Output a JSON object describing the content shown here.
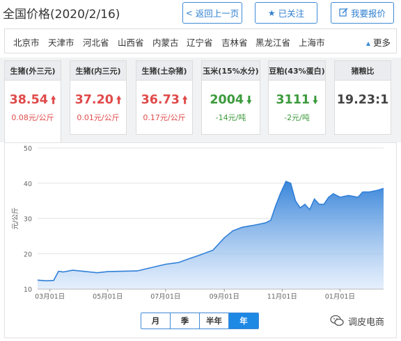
{
  "header": {
    "title": "全国价格(2020/2/16)",
    "back_label": "返回上一页",
    "follow_label": "已关注",
    "report_label": "我要报价"
  },
  "regions": {
    "items": [
      "北京市",
      "天津市",
      "河北省",
      "山西省",
      "内蒙古",
      "辽宁省",
      "吉林省",
      "黑龙江省",
      "上海市"
    ],
    "more_label": "更多"
  },
  "cards": [
    {
      "title": "生猪(外三元)",
      "value": "38.54",
      "trend": "up",
      "change": "0.08元/公斤"
    },
    {
      "title": "生猪(内三元)",
      "value": "37.20",
      "trend": "up",
      "change": "0.01元/公斤"
    },
    {
      "title": "生猪(土杂猪)",
      "value": "36.73",
      "trend": "up",
      "change": "0.17元/公斤"
    },
    {
      "title": "玉米(15%水分)",
      "value": "2004",
      "trend": "down",
      "change": "-14元/吨"
    },
    {
      "title": "豆粕(43%蛋白)",
      "value": "3111",
      "trend": "down",
      "change": "-2元/吨"
    },
    {
      "title": "猪粮比",
      "value": "19.23:1",
      "trend": "none",
      "change": ""
    }
  ],
  "colors": {
    "accent": "#1e88e5",
    "up": "#e04a4a",
    "down": "#3c9a3c",
    "line": "#2f7fd8"
  },
  "chart_data": {
    "type": "area",
    "ylabel": "元/公斤",
    "ylim": [
      10,
      50
    ],
    "yticks": [
      10,
      20,
      30,
      40,
      50
    ],
    "grid": true,
    "xticks": [
      "03月01日",
      "05月01日",
      "07月01日",
      "09月01日",
      "11月01日",
      "01月01日"
    ],
    "x": [
      "2019-02-16",
      "2019-02-25",
      "2019-03-05",
      "2019-03-10",
      "2019-03-15",
      "2019-03-25",
      "2019-04-05",
      "2019-04-20",
      "2019-05-01",
      "2019-05-15",
      "2019-06-01",
      "2019-06-15",
      "2019-07-01",
      "2019-07-15",
      "2019-07-25",
      "2019-08-05",
      "2019-08-20",
      "2019-09-01",
      "2019-09-10",
      "2019-09-20",
      "2019-10-01",
      "2019-10-10",
      "2019-10-15",
      "2019-10-20",
      "2019-10-25",
      "2019-10-30",
      "2019-11-05",
      "2019-11-10",
      "2019-11-15",
      "2019-11-20",
      "2019-11-25",
      "2019-11-30",
      "2019-12-05",
      "2019-12-10",
      "2019-12-15",
      "2019-12-20",
      "2019-12-25",
      "2020-01-01",
      "2020-01-10",
      "2020-01-20",
      "2020-01-25",
      "2020-02-01",
      "2020-02-10",
      "2020-02-16"
    ],
    "series": [
      {
        "values": [
          12.5,
          12.3,
          12.4,
          15.0,
          14.8,
          15.3,
          15.0,
          14.6,
          14.9,
          15.0,
          15.1,
          16.0,
          17.0,
          17.5,
          18.5,
          19.5,
          21.0,
          24.5,
          26.5,
          27.5,
          28.0,
          28.5,
          28.8,
          29.5,
          33.5,
          37.0,
          40.5,
          40.0,
          35.0,
          33.0,
          34.0,
          32.5,
          35.5,
          34.0,
          34.0,
          36.0,
          37.0,
          36.0,
          36.5,
          36.0,
          37.5,
          37.5,
          38.0,
          38.54
        ]
      }
    ]
  },
  "ranges": {
    "items": [
      "月",
      "季",
      "半年",
      "年"
    ],
    "selected": "年"
  },
  "watermark": {
    "text": "调皮电商"
  }
}
